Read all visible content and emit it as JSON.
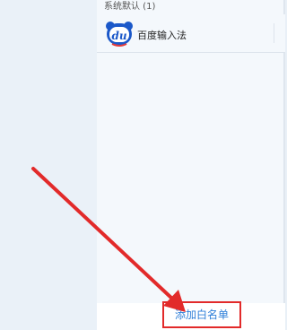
{
  "section": {
    "title": "系统默认 (1)"
  },
  "apps": [
    {
      "name": "百度输入法",
      "icon": "baidu-input-icon",
      "icon_text": "du"
    }
  ],
  "footer": {
    "add_whitelist_label": "添加白名单"
  },
  "annotation": {
    "arrow_color": "#e22a2a",
    "highlight_color": "#e22a2a"
  },
  "colors": {
    "link": "#2f7fd8",
    "panel_bg": "#f4f8fc",
    "sidebar_bg": "#eaf1f8"
  }
}
